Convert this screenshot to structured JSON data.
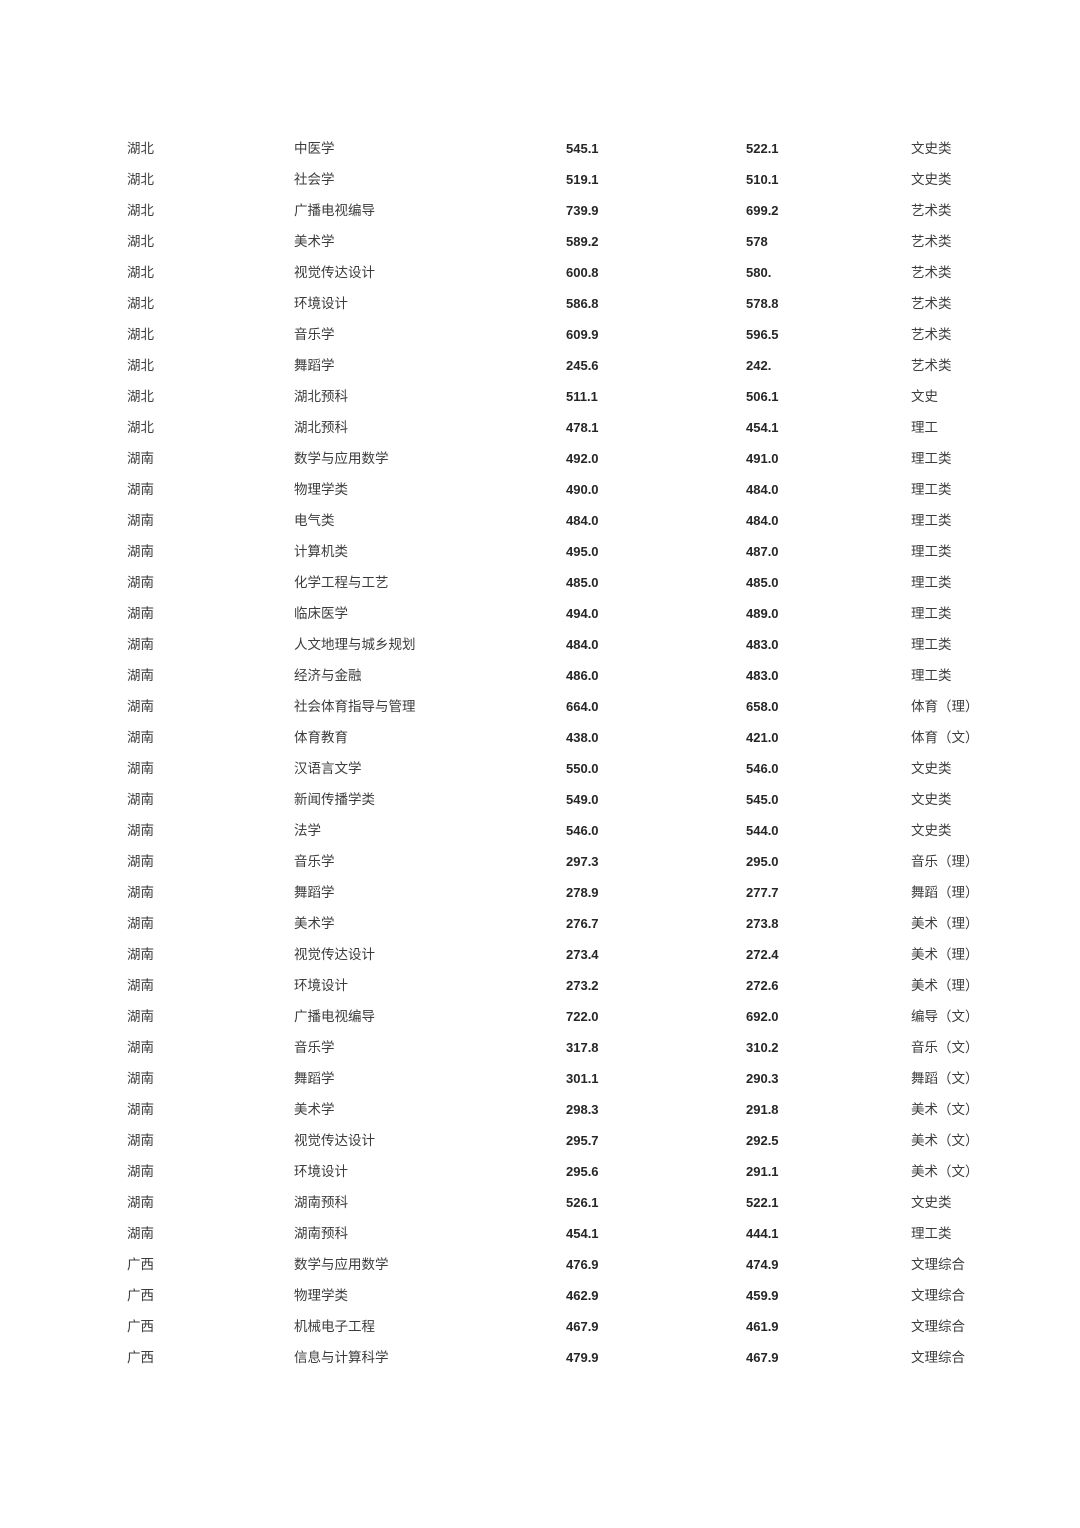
{
  "document": {
    "type": "admission-score-table",
    "page_background": "#ffffff",
    "text_color": "#3c3c3c",
    "number_color": "#262626"
  },
  "table": {
    "columns": [
      {
        "key": "province",
        "name": "province-column"
      },
      {
        "key": "major",
        "name": "major-column"
      },
      {
        "key": "high_score",
        "name": "high-score-column"
      },
      {
        "key": "low_score",
        "name": "low-score-column"
      },
      {
        "key": "category",
        "name": "category-column"
      }
    ],
    "rows": [
      {
        "province": "湖北",
        "major": "中医学",
        "high_score": "545.1",
        "low_score": "522.1",
        "category": "文史类"
      },
      {
        "province": "湖北",
        "major": "社会学",
        "high_score": "519.1",
        "low_score": "510.1",
        "category": "文史类"
      },
      {
        "province": "湖北",
        "major": "广播电视编导",
        "high_score": "739.9",
        "low_score": "699.2",
        "category": "艺术类"
      },
      {
        "province": "湖北",
        "major": "美术学",
        "high_score": "589.2",
        "low_score": "578",
        "category": "艺术类"
      },
      {
        "province": "湖北",
        "major": "视觉传达设计",
        "high_score": "600.8",
        "low_score": "580.",
        "category": "艺术类"
      },
      {
        "province": "湖北",
        "major": "环境设计",
        "high_score": "586.8",
        "low_score": "578.8",
        "category": "艺术类"
      },
      {
        "province": "湖北",
        "major": "音乐学",
        "high_score": "609.9",
        "low_score": "596.5",
        "category": "艺术类"
      },
      {
        "province": "湖北",
        "major": "舞蹈学",
        "high_score": "245.6",
        "low_score": "242.",
        "category": "艺术类"
      },
      {
        "province": "湖北",
        "major": "湖北预科",
        "high_score": "511.1",
        "low_score": "506.1",
        "category": "文史"
      },
      {
        "province": "湖北",
        "major": "湖北预科",
        "high_score": "478.1",
        "low_score": "454.1",
        "category": "理工"
      },
      {
        "province": "湖南",
        "major": "数学与应用数学",
        "high_score": "492.0",
        "low_score": "491.0",
        "category": "理工类"
      },
      {
        "province": "湖南",
        "major": "物理学类",
        "high_score": "490.0",
        "low_score": "484.0",
        "category": "理工类"
      },
      {
        "province": "湖南",
        "major": "电气类",
        "high_score": "484.0",
        "low_score": "484.0",
        "category": "理工类"
      },
      {
        "province": "湖南",
        "major": "计算机类",
        "high_score": "495.0",
        "low_score": "487.0",
        "category": "理工类"
      },
      {
        "province": "湖南",
        "major": "化学工程与工艺",
        "high_score": "485.0",
        "low_score": "485.0",
        "category": "理工类"
      },
      {
        "province": "湖南",
        "major": "临床医学",
        "high_score": "494.0",
        "low_score": "489.0",
        "category": "理工类"
      },
      {
        "province": "湖南",
        "major": "人文地理与城乡规划",
        "high_score": "484.0",
        "low_score": "483.0",
        "category": "理工类"
      },
      {
        "province": "湖南",
        "major": "经济与金融",
        "high_score": "486.0",
        "low_score": "483.0",
        "category": "理工类"
      },
      {
        "province": "湖南",
        "major": "社会体育指导与管理",
        "high_score": "664.0",
        "low_score": "658.0",
        "category": "体育（理）"
      },
      {
        "province": "湖南",
        "major": "体育教育",
        "high_score": "438.0",
        "low_score": "421.0",
        "category": "体育（文）"
      },
      {
        "province": "湖南",
        "major": "汉语言文学",
        "high_score": "550.0",
        "low_score": "546.0",
        "category": "文史类"
      },
      {
        "province": "湖南",
        "major": "新闻传播学类",
        "high_score": "549.0",
        "low_score": "545.0",
        "category": "文史类"
      },
      {
        "province": "湖南",
        "major": "法学",
        "high_score": "546.0",
        "low_score": "544.0",
        "category": "文史类"
      },
      {
        "province": "湖南",
        "major": "音乐学",
        "high_score": "297.3",
        "low_score": "295.0",
        "category": "音乐（理）"
      },
      {
        "province": "湖南",
        "major": "舞蹈学",
        "high_score": "278.9",
        "low_score": "277.7",
        "category": "舞蹈（理）"
      },
      {
        "province": "湖南",
        "major": "美术学",
        "high_score": "276.7",
        "low_score": "273.8",
        "category": "美术（理）"
      },
      {
        "province": "湖南",
        "major": "视觉传达设计",
        "high_score": "273.4",
        "low_score": "272.4",
        "category": "美术（理）"
      },
      {
        "province": "湖南",
        "major": "环境设计",
        "high_score": "273.2",
        "low_score": "272.6",
        "category": "美术（理）"
      },
      {
        "province": "湖南",
        "major": "广播电视编导",
        "high_score": "722.0",
        "low_score": "692.0",
        "category": "编导（文）"
      },
      {
        "province": "湖南",
        "major": "音乐学",
        "high_score": "317.8",
        "low_score": "310.2",
        "category": "音乐（文）"
      },
      {
        "province": "湖南",
        "major": "舞蹈学",
        "high_score": "301.1",
        "low_score": "290.3",
        "category": "舞蹈（文）"
      },
      {
        "province": "湖南",
        "major": "美术学",
        "high_score": "298.3",
        "low_score": "291.8",
        "category": "美术（文）"
      },
      {
        "province": "湖南",
        "major": "视觉传达设计",
        "high_score": "295.7",
        "low_score": "292.5",
        "category": "美术（文）"
      },
      {
        "province": "湖南",
        "major": "环境设计",
        "high_score": "295.6",
        "low_score": "291.1",
        "category": "美术（文）"
      },
      {
        "province": "湖南",
        "major": "湖南预科",
        "high_score": "526.1",
        "low_score": "522.1",
        "category": "文史类"
      },
      {
        "province": "湖南",
        "major": "湖南预科",
        "high_score": "454.1",
        "low_score": "444.1",
        "category": "理工类"
      },
      {
        "province": "广西",
        "major": "数学与应用数学",
        "high_score": "476.9",
        "low_score": "474.9",
        "category": "文理综合"
      },
      {
        "province": "广西",
        "major": "物理学类",
        "high_score": "462.9",
        "low_score": "459.9",
        "category": "文理综合"
      },
      {
        "province": "广西",
        "major": "机械电子工程",
        "high_score": "467.9",
        "low_score": "461.9",
        "category": "文理综合"
      },
      {
        "province": "广西",
        "major": "信息与计算科学",
        "high_score": "479.9",
        "low_score": "467.9",
        "category": "文理综合"
      }
    ]
  }
}
